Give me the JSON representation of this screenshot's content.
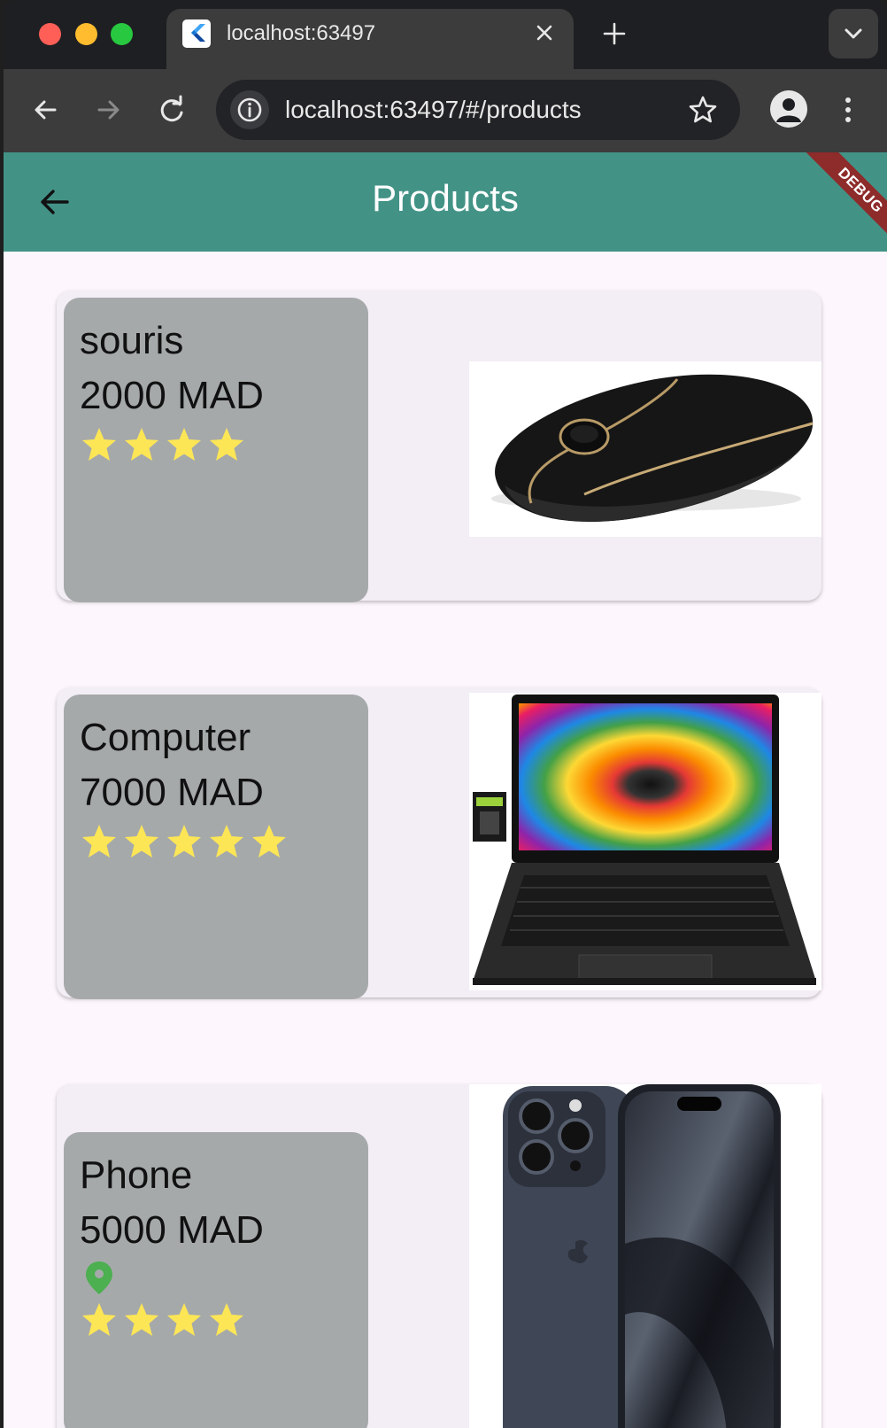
{
  "browser": {
    "tab_title": "localhost:63497",
    "url": "localhost:63497/#/products"
  },
  "appbar": {
    "title": "Products",
    "debug_label": "DEBUG",
    "color": "#429386"
  },
  "products": [
    {
      "name": "souris",
      "price": "2000 MAD",
      "rating": 4,
      "image": "wireless-mouse-image"
    },
    {
      "name": "Computer",
      "price": "7000 MAD",
      "rating": 5,
      "image": "laptop-image"
    },
    {
      "name": "Phone",
      "price": "5000 MAD",
      "rating": 4,
      "location_icon": "location-pin-icon",
      "image": "smartphone-image"
    }
  ]
}
